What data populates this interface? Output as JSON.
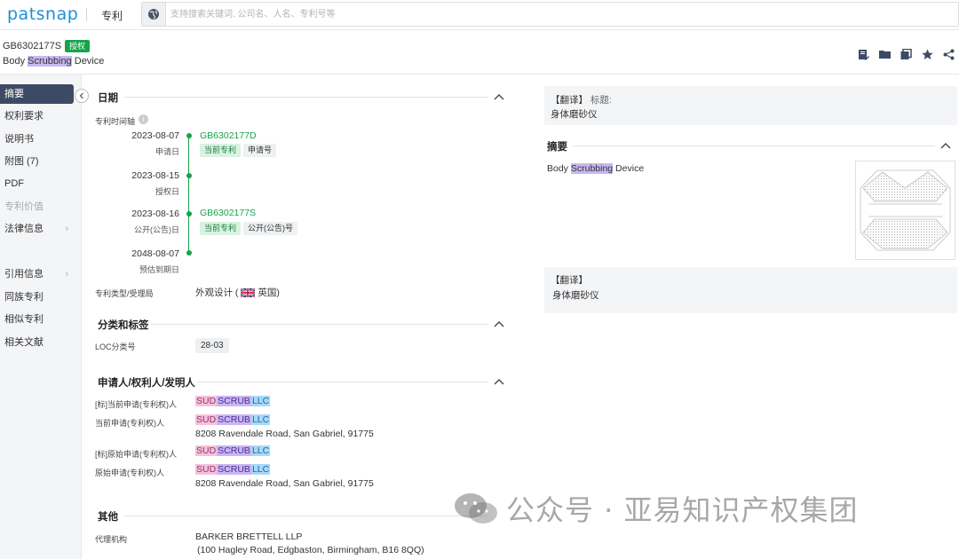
{
  "topbar": {
    "logo": "patsnap",
    "nav_title": "专利",
    "search_placeholder": "支持搜索关键词, 公司名、人名、专利号等"
  },
  "header": {
    "pub_number": "GB6302177S",
    "status_badge": "授权",
    "title_before": "Body ",
    "title_highlight": "Scrubbing",
    "title_after": " Device"
  },
  "sidebar": {
    "items": [
      {
        "label": "摘要",
        "active": true
      },
      {
        "label": "权利要求"
      },
      {
        "label": "说明书"
      },
      {
        "label": "附图 (7)"
      },
      {
        "label": "PDF"
      },
      {
        "label": "专利价值",
        "disabled": true
      },
      {
        "label": "法律信息",
        "chevron": "›"
      },
      {
        "label": "引用信息",
        "chevron": "›"
      },
      {
        "label": "同族专利"
      },
      {
        "label": "相似专利"
      },
      {
        "label": "相关文献"
      }
    ]
  },
  "dates": {
    "section_title": "日期",
    "timeline_label": "专利时间轴",
    "info_icon": "i",
    "events": [
      {
        "date": "2023-08-07",
        "sub": "申请日",
        "link": "GB6302177D",
        "tags": [
          "当前专利",
          "申请号"
        ]
      },
      {
        "date": "2023-08-15",
        "sub": "授权日"
      },
      {
        "date": "2023-08-16",
        "sub": "公开(公告)日",
        "link": "GB6302177S",
        "tags": [
          "当前专利",
          "公开(公告)号"
        ]
      },
      {
        "date": "2048-08-07",
        "sub": "预估到期日"
      }
    ],
    "type_label": "专利类型/受理局",
    "type_value": "外观设计 (",
    "office_value": "英国)"
  },
  "classification": {
    "section_title": "分类和标签",
    "loc_label": "LOC分类号",
    "loc_value": "28-03"
  },
  "parties": {
    "section_title": "申请人/权利人/发明人",
    "name_parts": [
      "SUD",
      "SCRUB",
      "LLC"
    ],
    "rows": [
      {
        "label": "[标]当前申请(专利权)人"
      },
      {
        "label": "当前申请(专利权)人",
        "address": "8208 Ravendale Road, San Gabriel, 91775"
      },
      {
        "label": "[标]原始申请(专利权)人"
      },
      {
        "label": "原始申请(专利权)人",
        "address": "8208 Ravendale Road, San Gabriel, 91775"
      }
    ]
  },
  "other": {
    "section_title": "其他",
    "agent_label": "代理机构",
    "agent_name": "BARKER BRETTELL LLP",
    "agent_address": "(100 Hagley Road, Edgbaston, Birmingham, B16 8QQ)"
  },
  "right": {
    "title_trans_label": "【翻译】",
    "title_trans_field": "标题:",
    "title_trans_value": "身体磨砂仪",
    "abstract_title": "摘要",
    "abstract_before": "Body ",
    "abstract_highlight": "Scrubbing",
    "abstract_after": " Device",
    "abstract_trans_label": "【翻译】",
    "abstract_trans_value": "身体磨砂仪"
  },
  "watermark": {
    "text": "公众号 · 亚易知识产权集团"
  },
  "colors": {
    "brand": "#1f8fd6",
    "green": "#17a34a",
    "sidebar_active": "#3c4b63"
  }
}
